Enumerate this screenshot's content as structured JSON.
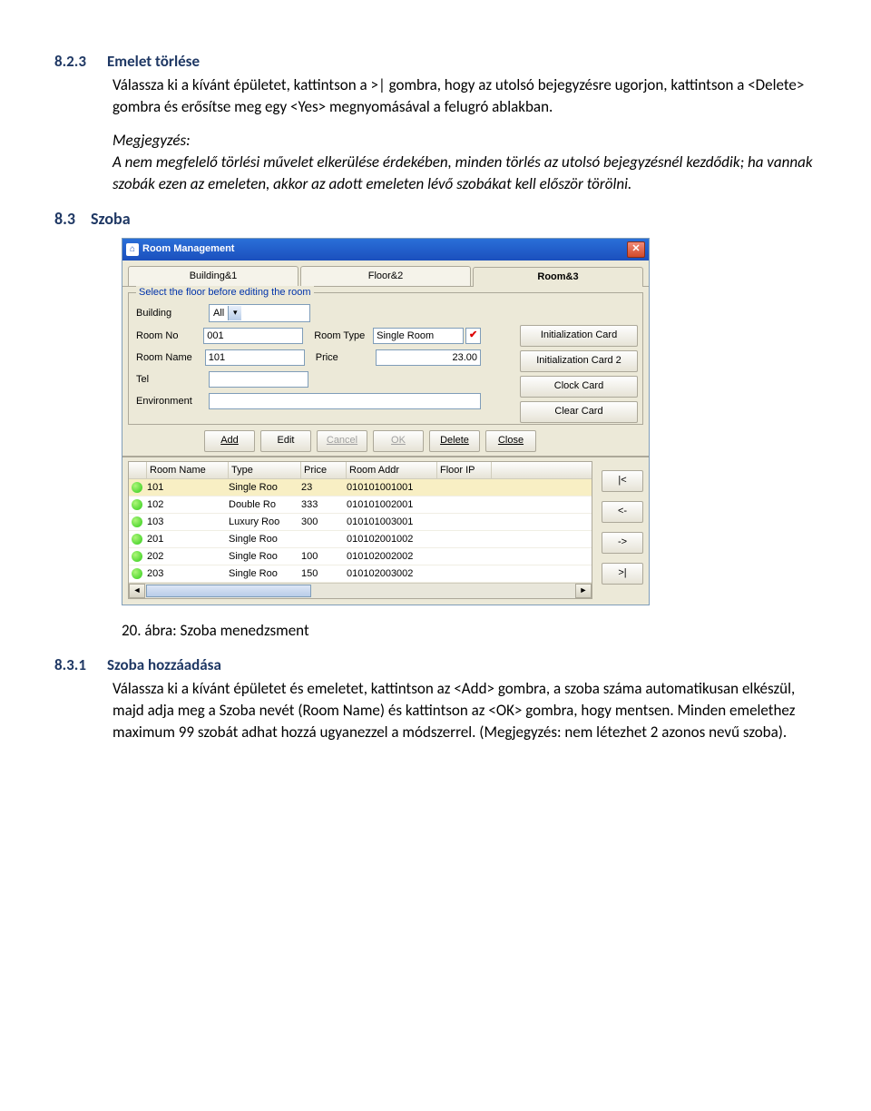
{
  "s823": {
    "num": "8.2.3",
    "title": "Emelet törlése",
    "body": "Válassza ki a kívánt épületet, kattintson a  >| gombra, hogy az utolsó bejegyzésre ugorjon, kattintson a <Delete> gombra és erősítse meg egy <Yes> megnyomásával a felugró ablakban.",
    "note_label": "Megjegyzés:",
    "note_body": "A nem megfelelő törlési művelet elkerülése érdekében, minden törlés az utolsó bejegyzésnél kezdődik; ha vannak szobák ezen az emeleten, akkor az adott emeleten lévő szobákat kell először törölni."
  },
  "s83": {
    "num": "8.3",
    "title": "Szoba"
  },
  "caption": "20. ábra: Szoba menedzsment",
  "s831": {
    "num": "8.3.1",
    "title": "Szoba hozzáadása",
    "body": "Válassza ki a kívánt épületet és emeletet, kattintson az <Add> gombra, a szoba száma automatikusan elkészül, majd adja meg a Szoba nevét (Room Name) és kattintson az <OK> gombra, hogy mentsen. Minden emelethez maximum 99 szobát adhat hozzá ugyanezzel a módszerrel. (Megjegyzés: nem létezhet 2 azonos nevű szoba)."
  },
  "win": {
    "title": "Room Management",
    "tabs": [
      "Building&1",
      "Floor&2",
      "Room&3"
    ],
    "group_label": "Select the floor before editing the room",
    "labels": {
      "building": "Building",
      "roomno": "Room No",
      "roomtype": "Room Type",
      "roomname": "Room Name",
      "price": "Price",
      "tel": "Tel",
      "env": "Environment"
    },
    "values": {
      "building": "All",
      "roomno": "001",
      "roomtype": "Single Room",
      "roomname": "101",
      "price": "23.00",
      "tel": "",
      "env": ""
    },
    "side_buttons": [
      "Initialization Card",
      "Initialization Card 2",
      "Clock Card",
      "Clear Card"
    ],
    "action_buttons": [
      "Add",
      "Edit",
      "Cancel",
      "OK",
      "Delete",
      "Close"
    ],
    "table": {
      "headers": [
        "",
        "Room Name",
        "Type",
        "Price",
        "Room Addr",
        "Floor IP"
      ],
      "rows": [
        [
          "101",
          "Single Roo",
          "23",
          "010101001001",
          ""
        ],
        [
          "102",
          "Double Ro",
          "333",
          "010101002001",
          ""
        ],
        [
          "103",
          "Luxury Roo",
          "300",
          "010101003001",
          ""
        ],
        [
          "201",
          "Single Roo",
          "",
          "010102001002",
          ""
        ],
        [
          "202",
          "Single Roo",
          "100",
          "010102002002",
          ""
        ],
        [
          "203",
          "Single Roo",
          "150",
          "010102003002",
          ""
        ]
      ]
    },
    "nav": [
      "|<",
      "<-",
      "->",
      ">|"
    ]
  }
}
